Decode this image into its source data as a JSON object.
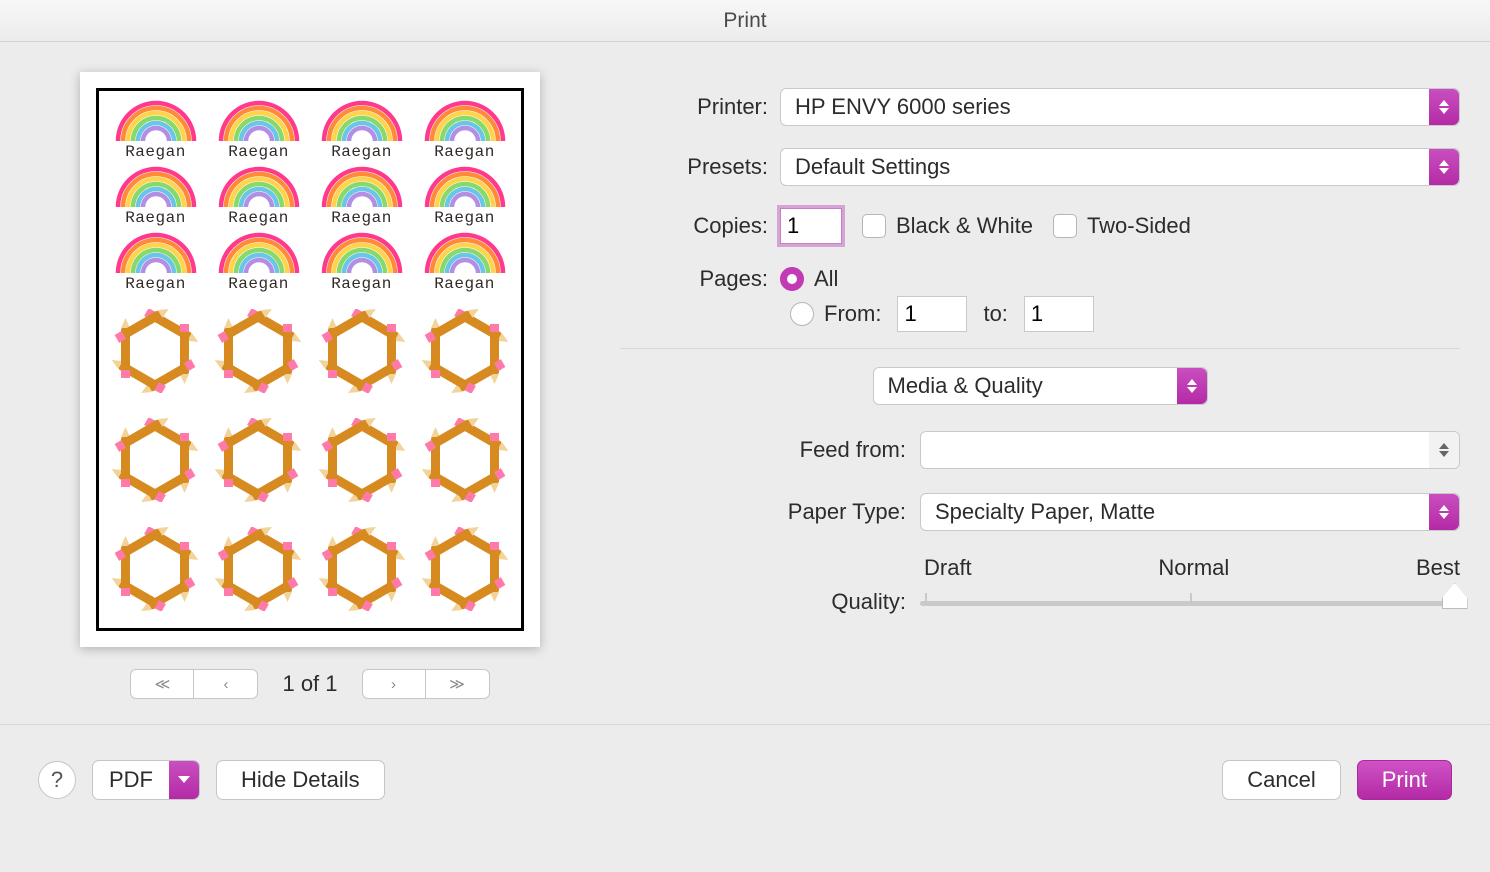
{
  "window": {
    "title": "Print"
  },
  "preview": {
    "name_label": "Raegan",
    "pager": {
      "first": "≪",
      "prev": "‹",
      "next": "›",
      "last": "≫",
      "status": "1 of 1"
    }
  },
  "options": {
    "printer_label": "Printer:",
    "printer_value": "HP ENVY 6000 series",
    "presets_label": "Presets:",
    "presets_value": "Default Settings",
    "copies_label": "Copies:",
    "copies_value": "1",
    "bw_label": "Black & White",
    "two_sided_label": "Two-Sided",
    "pages_label": "Pages:",
    "pages_all_label": "All",
    "pages_from_label": "From:",
    "pages_from_value": "1",
    "pages_to_label": "to:",
    "pages_to_value": "1",
    "section_label": "Media & Quality",
    "feed_label": "Feed from:",
    "feed_value": "",
    "paper_label": "Paper Type:",
    "paper_value": "Specialty Paper, Matte",
    "quality_label": "Quality:",
    "quality_ticks": {
      "draft": "Draft",
      "normal": "Normal",
      "best": "Best"
    }
  },
  "footer": {
    "help": "?",
    "pdf_label": "PDF",
    "hide_details_label": "Hide Details",
    "cancel_label": "Cancel",
    "print_label": "Print"
  }
}
